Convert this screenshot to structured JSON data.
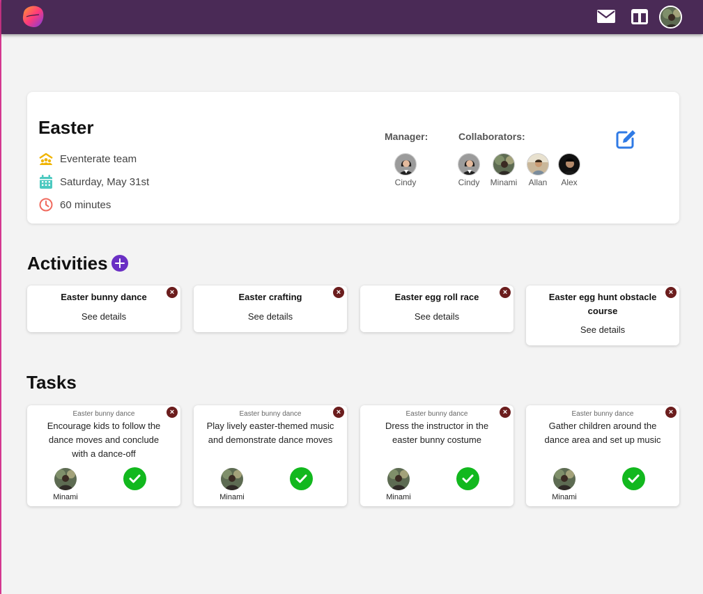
{
  "header": {
    "logo_icon": "eventerate-logo-icon",
    "mail_icon": "mail-icon",
    "board_icon": "board-icon",
    "avatar_icon": "user-avatar-icon",
    "color": "#4a2a56"
  },
  "event": {
    "title": "Easter",
    "team": "Eventerate team",
    "date": "Saturday, May 31st",
    "duration": "60 minutes",
    "manager_label": "Manager:",
    "collaborators_label": "Collaborators:",
    "manager": {
      "name": "Cindy"
    },
    "collaborators": [
      {
        "name": "Cindy"
      },
      {
        "name": "Minami"
      },
      {
        "name": "Allan"
      },
      {
        "name": "Alex"
      }
    ]
  },
  "activities": {
    "title": "Activities",
    "items": [
      {
        "title": "Easter bunny dance",
        "link": "See details"
      },
      {
        "title": "Easter crafting",
        "link": "See details"
      },
      {
        "title": "Easter egg roll race",
        "link": "See details"
      },
      {
        "title": "Easter egg hunt obstacle course",
        "link": "See details"
      }
    ]
  },
  "tasks": {
    "title": "Tasks",
    "items": [
      {
        "category": "Easter bunny dance",
        "description": "Encourage kids to follow the dance moves and conclude with a dance-off",
        "assignee": "Minami"
      },
      {
        "category": "Easter bunny dance",
        "description": "Play lively easter-themed music and demonstrate dance moves",
        "assignee": "Minami"
      },
      {
        "category": "Easter bunny dance",
        "description": "Dress the instructor in the easter bunny costume",
        "assignee": "Minami"
      },
      {
        "category": "Easter bunny dance",
        "description": "Gather children around the dance area and set up music",
        "assignee": "Minami"
      }
    ]
  },
  "close_glyph": "×",
  "colors": {
    "accent": "#6a2fc4",
    "delete": "#6b1d1d",
    "done": "#12b81e",
    "edit": "#2f7ae5"
  }
}
